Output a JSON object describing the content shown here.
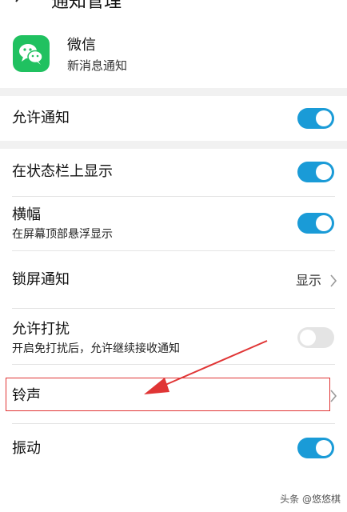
{
  "header": {
    "title": "通知管理"
  },
  "app": {
    "name": "微信",
    "subtitle": "新消息通知",
    "icon_color": "#20c160"
  },
  "rows": {
    "allow": {
      "label": "允许通知",
      "enabled": true
    },
    "statusbar": {
      "label": "在状态栏上显示",
      "enabled": true
    },
    "banner": {
      "label": "横幅",
      "sub": "在屏幕顶部悬浮显示",
      "enabled": true
    },
    "lockscreen": {
      "label": "锁屏通知",
      "value": "显示"
    },
    "dnd": {
      "label": "允许打扰",
      "sub": "开启免打扰后，允许继续接收通知",
      "enabled": false
    },
    "ringtone": {
      "label": "铃声"
    },
    "vibrate": {
      "label": "振动",
      "enabled": true
    }
  },
  "colors": {
    "accent": "#1a9bd7",
    "annotation": "#e03535"
  },
  "watermark": "头条 @悠悠棋"
}
